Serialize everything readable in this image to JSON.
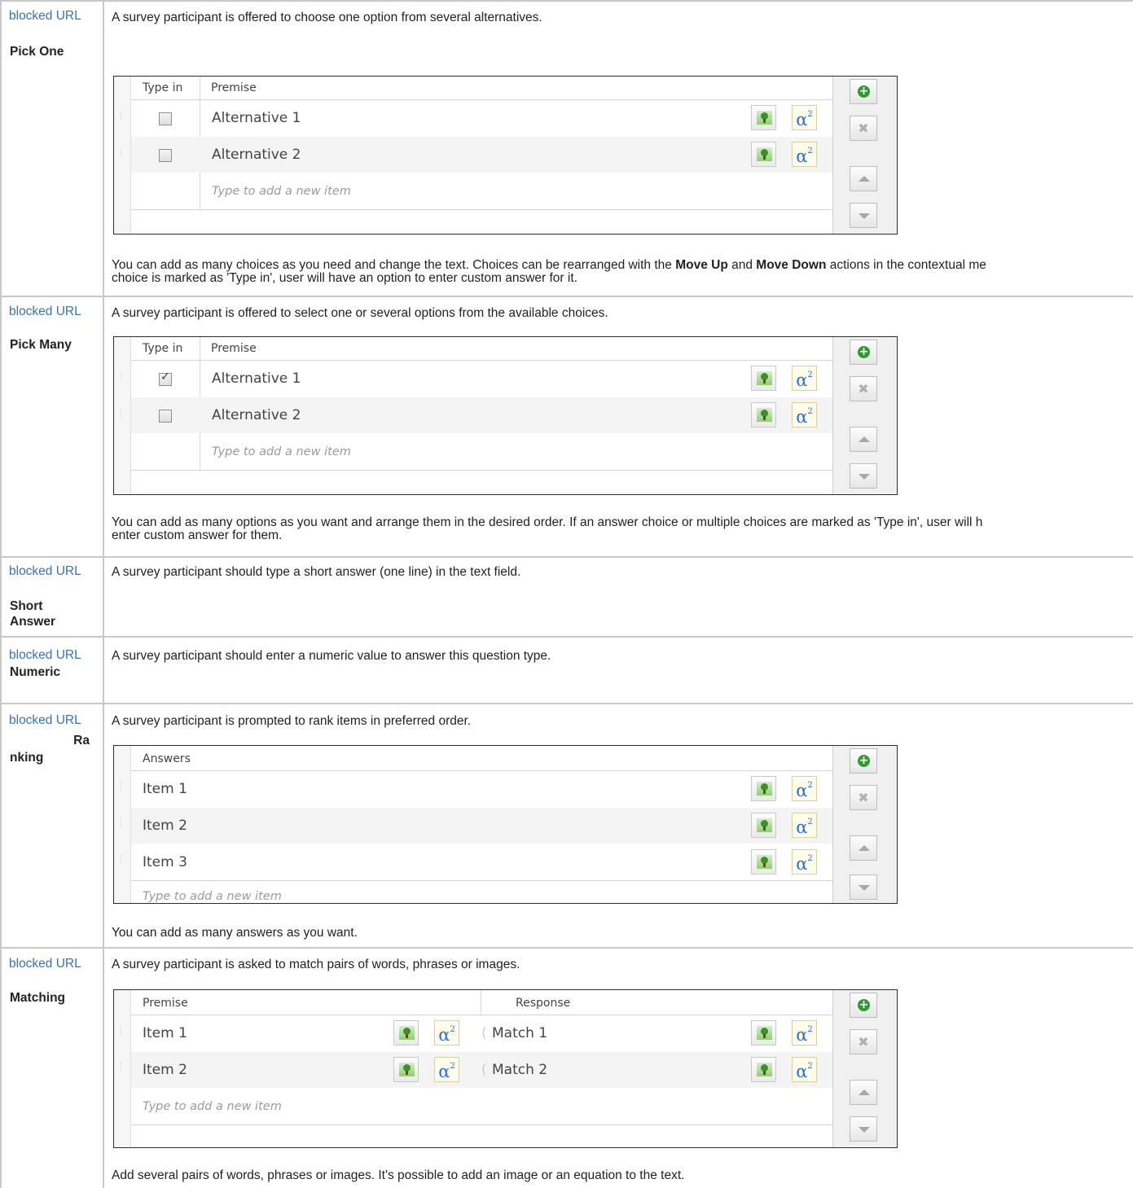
{
  "link_text": "blocked URL",
  "rows": {
    "pick_one": {
      "label": "Pick One",
      "description": "A survey participant is offered to choose one option from several alternatives.",
      "editor": {
        "col_typein": "Type in",
        "col_premise": "Premise",
        "items": [
          "Alternative 1",
          "Alternative 2"
        ],
        "typein_checked": [
          false,
          false
        ],
        "new_item_placeholder": "Type to add a new item"
      },
      "note_a": "You can add as many choices as you need and change the text. Choices can be rearranged with the ",
      "note_b": "Move Up",
      "note_c": " and ",
      "note_d": "Move Down",
      "note_e": " actions in the contextual me",
      "note_f": "choice is marked as 'Type in', user will have an option to enter custom answer for it."
    },
    "pick_many": {
      "label": "Pick Many",
      "description": "A survey participant is offered to select one or several options from the available choices.",
      "editor": {
        "col_typein": "Type in",
        "col_premise": "Premise",
        "items": [
          "Alternative 1",
          "Alternative 2"
        ],
        "typein_checked": [
          true,
          false
        ],
        "new_item_placeholder": "Type to add a new item"
      },
      "note_line1": "You can add as many options as you want and arrange them in the desired order. If an answer choice or multiple choices are marked as 'Type in', user will h",
      "note_line2": "enter custom answer for them."
    },
    "short_answer": {
      "label_line1": "Short",
      "label_line2": "Answer",
      "description": "A survey participant should type a short answer (one line) in the text field."
    },
    "numeric": {
      "label": "Numeric",
      "description": "A survey participant should enter a numeric value to answer this question type."
    },
    "ranking": {
      "label_line1": "Ra",
      "label_line2": "nking",
      "description": "A survey participant is prompted to rank items in preferred order.",
      "editor": {
        "col_answers": "Answers",
        "items": [
          "Item 1",
          "Item 2",
          "Item 3"
        ],
        "new_item_placeholder": "Type to add a new item"
      },
      "note": "You can add as many answers as you want."
    },
    "matching": {
      "label": "Matching",
      "description": "A survey participant is asked to match pairs of words, phrases or images.",
      "editor": {
        "col_premise": "Premise",
        "col_response": "Response",
        "premises": [
          "Item 1",
          "Item 2"
        ],
        "responses": [
          "Match 1",
          "Match 2"
        ],
        "new_item_placeholder": "Type to add a new item"
      },
      "note": "Add several pairs of words, phrases or images. It's possible to add an image or an equation to the text."
    }
  },
  "side_buttons": {
    "add": "add-item",
    "delete": "delete-item",
    "up": "move-up",
    "down": "move-down"
  },
  "colors": {
    "link": "#3b73af",
    "add_green": "#2f9a2f",
    "equation_blue": "#2a6fd6",
    "grid": "#c8c8c8"
  }
}
